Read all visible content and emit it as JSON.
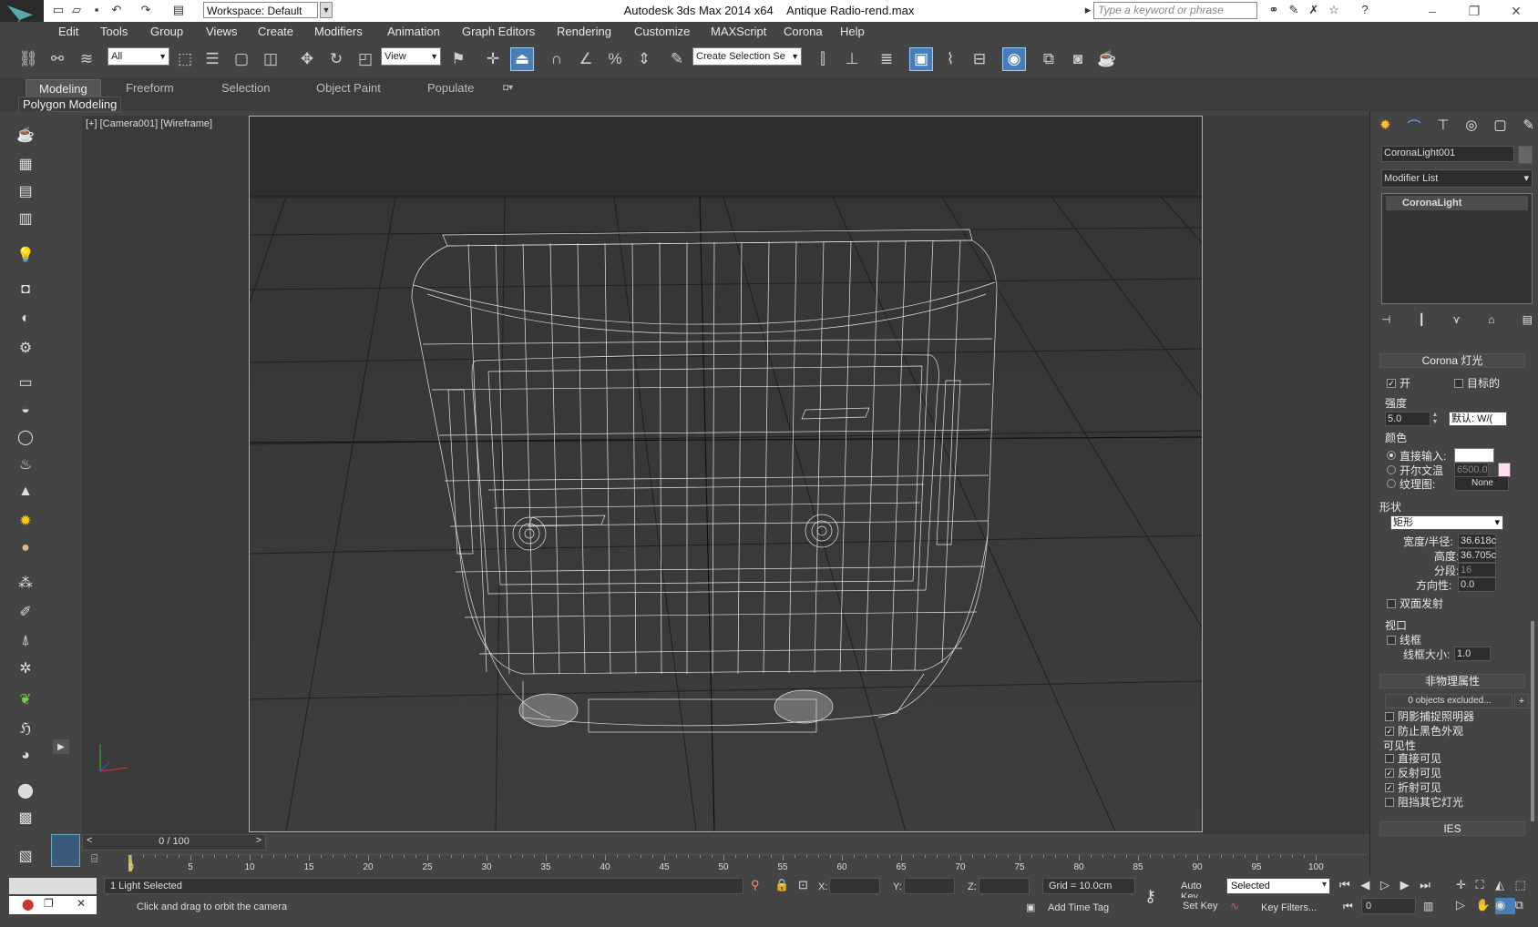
{
  "titlebar": {
    "app": "Autodesk 3ds Max  2014 x64",
    "file": "Antique Radio-rend.max",
    "workspace": "Workspace: Default",
    "search_placeholder": "Type a keyword or phrase"
  },
  "menu": [
    "Edit",
    "Tools",
    "Group",
    "Views",
    "Create",
    "Modifiers",
    "Animation",
    "Graph Editors",
    "Rendering",
    "Customize",
    "MAXScript",
    "Corona",
    "Help"
  ],
  "toolbar": {
    "filter_select": "All",
    "refcoord_select": "View",
    "named_selection": "Create Selection Se"
  },
  "ribbon": {
    "tabs": [
      "Modeling",
      "Freeform",
      "Selection",
      "Object Paint",
      "Populate"
    ],
    "active_tab": "Modeling",
    "panel": "Polygon Modeling"
  },
  "viewport": {
    "label": "[+] [Camera001] [Wireframe]"
  },
  "command_panel": {
    "object_name": "CoronaLight001",
    "modifier_list": "Modifier List",
    "stack_item": "CoronaLight",
    "rollout_main": "Corona 灯光",
    "on_label": "开",
    "on_checked": true,
    "target_label": "目标的",
    "target_checked": false,
    "intensity_label": "强度",
    "intensity_value": "5.0",
    "intensity_unit": "默认: W/(",
    "color_label": "颜色",
    "color_direct": "直接输入:",
    "color_kelvin": "开尔文温",
    "color_kelvin_value": "6500.0",
    "color_texmap": "纹理图:",
    "texmap_value": "None",
    "shape_label": "形状",
    "shape_value": "矩形",
    "width_label": "宽度/半径:",
    "width_value": "36.618c",
    "height_label": "高度:",
    "height_value": "36.705c",
    "segments_label": "分段:",
    "segments_value": "16",
    "directionality_label": "方向性:",
    "directionality_value": "0.0",
    "double_sided": "双面发射",
    "viewport_label": "视口",
    "wireframe_label": "线框",
    "wire_size_label": "线框大小:",
    "wire_size_value": "1.0",
    "rollout_nonphys": "非物理属性",
    "excluded": "0 objects excluded...",
    "shadow_catcher": "阴影捕捉照明器",
    "prevent_black": "防止黑色外观",
    "visibility_label": "可见性",
    "vis_direct": "直接可见",
    "vis_reflect": "反射可见",
    "vis_refract": "折射可见",
    "occlude": "阻挡其它灯光",
    "rollout_ies": "IES"
  },
  "timeline": {
    "frame": "0 / 100",
    "ticks": [
      "0",
      "5",
      "10",
      "15",
      "20",
      "25",
      "30",
      "35",
      "40",
      "45",
      "50",
      "55",
      "60",
      "65",
      "70",
      "75",
      "80",
      "85",
      "90",
      "95",
      "100"
    ]
  },
  "status": {
    "selection": "1 Light Selected",
    "prompt": "Click and drag to orbit the camera",
    "x_label": "X:",
    "y_label": "Y:",
    "z_label": "Z:",
    "grid": "Grid = 10.0cm",
    "add_time_tag": "Add Time Tag",
    "auto_key": "Auto Key",
    "set_key": "Set Key",
    "key_mode": "Selected",
    "key_filters": "Key Filters...",
    "current_frame": "0"
  }
}
